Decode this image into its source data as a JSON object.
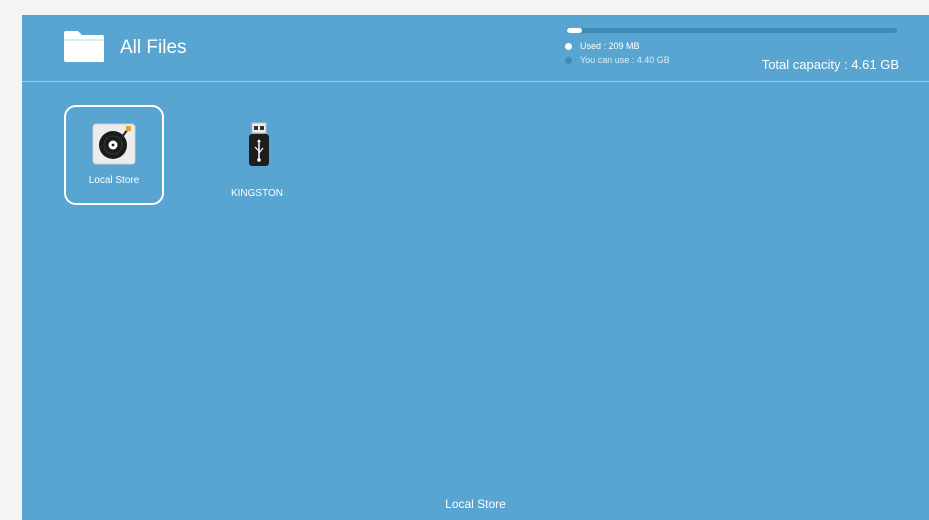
{
  "header": {
    "title": "All Files",
    "icon": "folder-icon"
  },
  "storage": {
    "used_label": "Used : 209 MB",
    "available_label": "You can use : 4.40 GB",
    "total_label": "Total capacity : 4.61 GB",
    "used_fraction": 0.045
  },
  "items": [
    {
      "label": "Local Store",
      "icon": "vinyl-record-icon",
      "selected": true
    },
    {
      "label": "KINGSTON",
      "icon": "usb-drive-icon",
      "selected": false
    }
  ],
  "footer": {
    "label": "Local Store"
  },
  "colors": {
    "background": "#57a5d0",
    "bar_track": "#3f8ab6",
    "text": "#ffffff"
  }
}
